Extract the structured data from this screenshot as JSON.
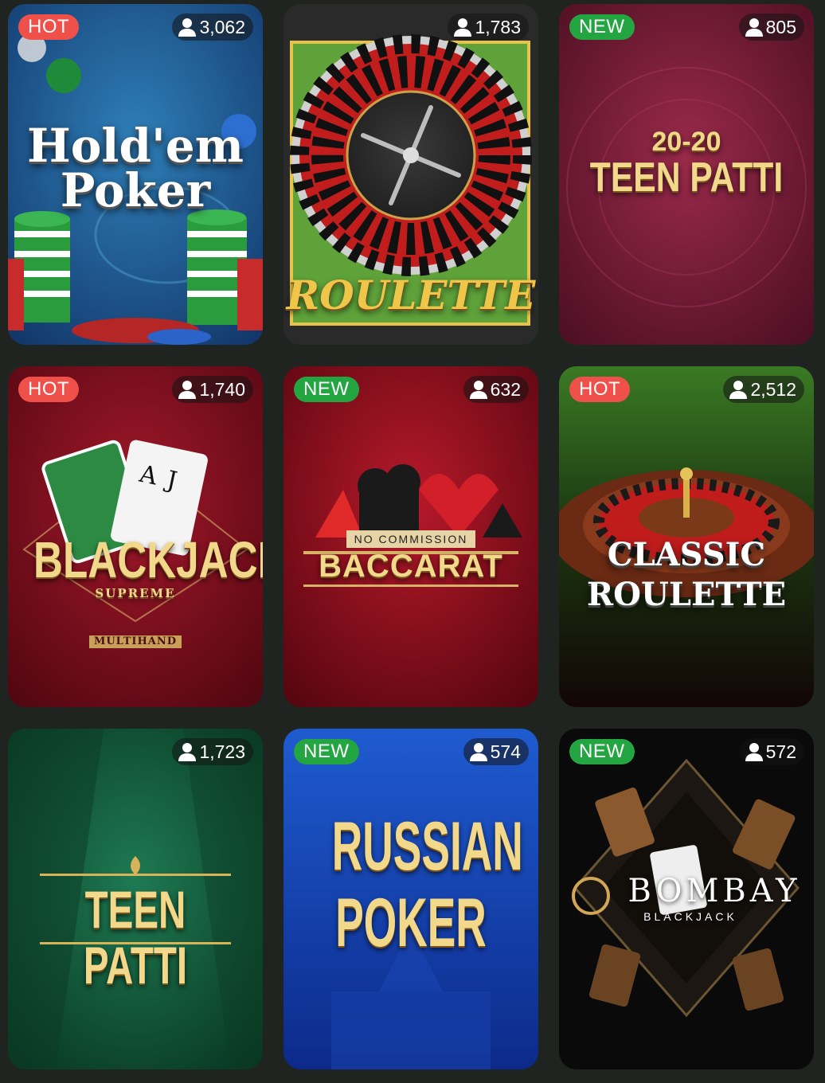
{
  "games": [
    {
      "title_lines": [
        "Hold'em",
        "Poker"
      ],
      "badge": "HOT",
      "players": "3,062"
    },
    {
      "title_lines": [
        "ROULETTE"
      ],
      "badge": "",
      "players": "1,783"
    },
    {
      "title_lines": [
        "20-20",
        "TEEN PATTI"
      ],
      "badge": "NEW",
      "players": "805"
    },
    {
      "title_lines": [
        "BLACKJACK",
        "SUPREME",
        "MULTIHAND"
      ],
      "badge": "HOT",
      "players": "1,740"
    },
    {
      "title_lines": [
        "NO COMMISSION",
        "BACCARAT"
      ],
      "badge": "NEW",
      "players": "632"
    },
    {
      "title_lines": [
        "CLASSIC",
        "ROULETTE"
      ],
      "badge": "HOT",
      "players": "2,512"
    },
    {
      "title_lines": [
        "TEEN PATTI"
      ],
      "badge": "",
      "players": "1,723"
    },
    {
      "title_lines": [
        "RUSSIAN",
        "POKER"
      ],
      "badge": "NEW",
      "players": "574"
    },
    {
      "title_lines": [
        "BOMBAY",
        "BLACKJACK"
      ],
      "badge": "NEW",
      "players": "572"
    }
  ],
  "icons": {
    "players": "user-icon"
  },
  "colors": {
    "hot": "#f0504a",
    "new": "#23a641",
    "background": "#1f2420",
    "gold": "#f1d88b"
  }
}
